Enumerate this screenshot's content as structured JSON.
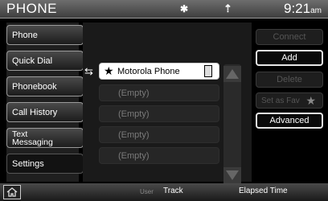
{
  "header": {
    "title": "PHONE",
    "bluetooth_glyph": "ʙ",
    "signal_glyph": "ẽ",
    "time": "9:21",
    "ampm": "am"
  },
  "nav": {
    "items": [
      {
        "label": "Phone"
      },
      {
        "label": "Quick Dial"
      },
      {
        "label": "Phonebook"
      },
      {
        "label": "Call History"
      },
      {
        "label": "Text Messaging"
      },
      {
        "label": "Settings"
      }
    ]
  },
  "list": {
    "rows": [
      {
        "label": "Motorola Phone",
        "active": true
      },
      {
        "label": "(Empty)"
      },
      {
        "label": "(Empty)"
      },
      {
        "label": "(Empty)"
      },
      {
        "label": "(Empty)"
      }
    ]
  },
  "actions": {
    "connect": "Connect",
    "add": "Add",
    "delete": "Delete",
    "set_as_fav": "Set as Fav",
    "advanced": "Advanced"
  },
  "footer": {
    "user": "User",
    "track": "Track",
    "elapsed": "Elapsed Time"
  },
  "icons": {
    "home": "home-icon",
    "star": "star-icon",
    "swap": "swap-arrows-icon",
    "phone": "phone-icon"
  },
  "colors": {
    "background": "#000000",
    "header": "#5a5a5a",
    "active_row": "#ffffff",
    "dim_text": "#555555"
  }
}
